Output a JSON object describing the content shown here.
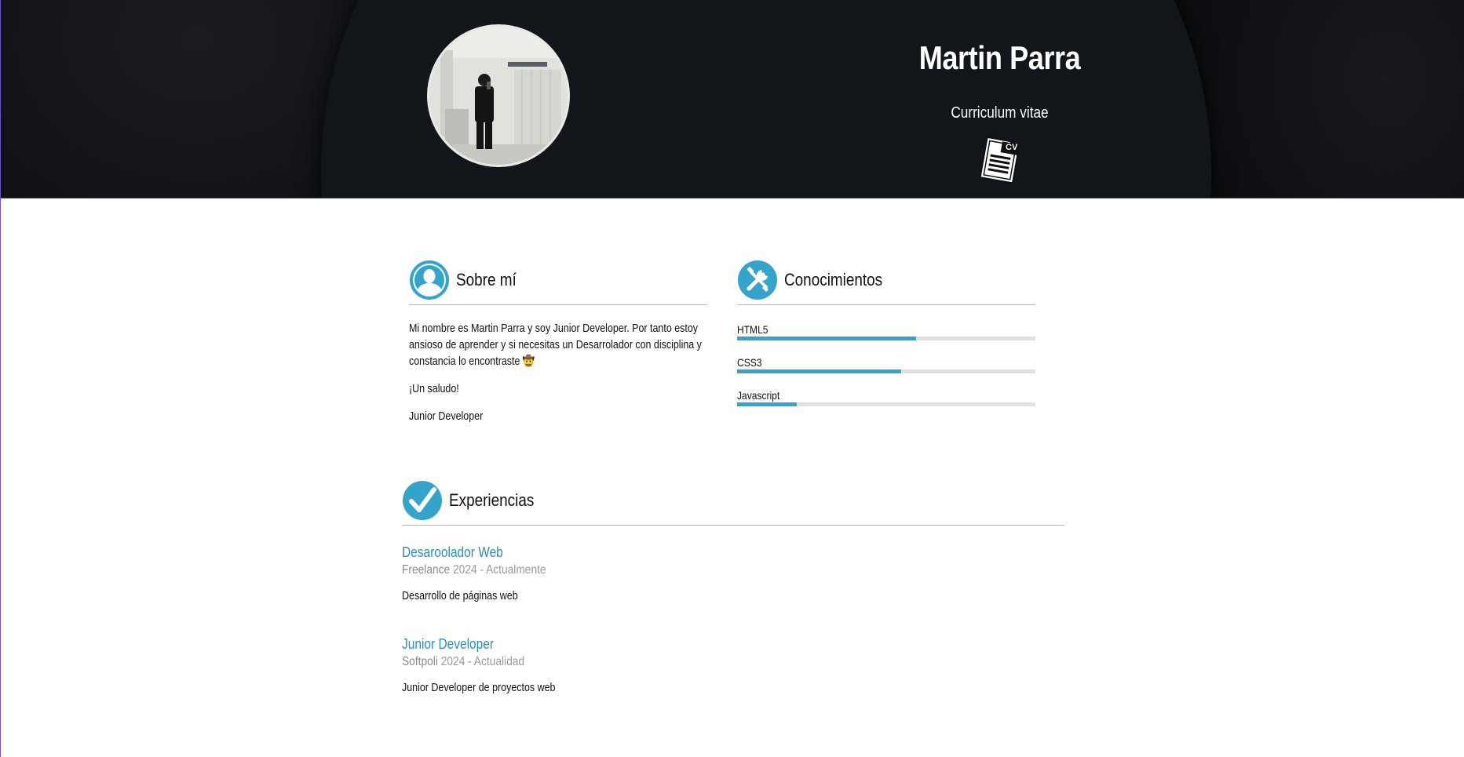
{
  "header": {
    "name": "Martin Parra",
    "cv_label": "Curriculum vitae",
    "cv_icon": "cv-document-icon",
    "cv_icon_text": "CV",
    "avatar_icon": "profile-photo"
  },
  "about": {
    "icon": "person-icon",
    "title": "Sobre mí",
    "paragraphs": [
      "Mi nombre es Martin Parra y soy Junior Developer. Por tanto estoy ansioso de aprender y si necesitas un Desarrolador con disciplina y constancia lo encontraste 🤠",
      "¡Un saludo!",
      "Junior Developer"
    ]
  },
  "skills": {
    "icon": "tools-icon",
    "title": "Conocimientos",
    "items": [
      {
        "name": "HTML5",
        "level": 0.6
      },
      {
        "name": "CSS3",
        "level": 0.55
      },
      {
        "name": "Javascript",
        "level": 0.2
      }
    ]
  },
  "experience": {
    "icon": "checkmark-icon",
    "title": "Experiencias",
    "items": [
      {
        "title": "Desaroolador Web",
        "company": "Freelance",
        "period": "2024 - Actualmente",
        "description": "Desarrollo de páginas web"
      },
      {
        "title": "Junior Developer",
        "company": "Softpoli",
        "period": "2024 - Actualidad",
        "description": "Junior Developer de proyectos web"
      }
    ]
  },
  "colors": {
    "accent": "#34a4cb",
    "link": "#2c8db6",
    "header_bg": "#0c0e11"
  }
}
